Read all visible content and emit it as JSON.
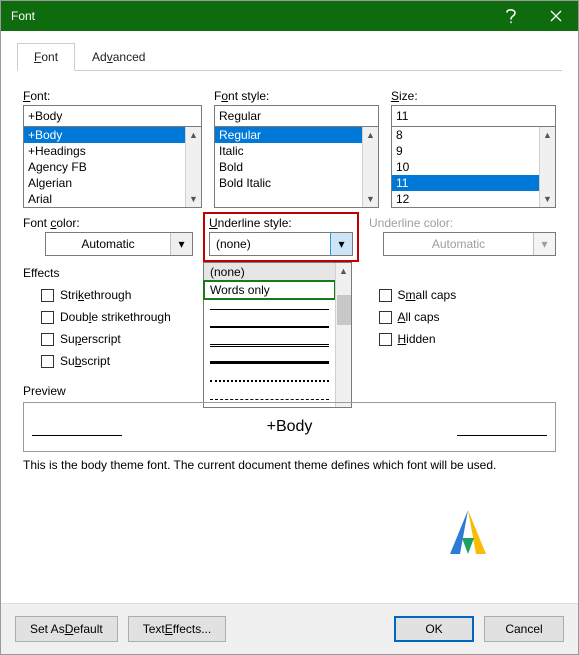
{
  "title": "Font",
  "tabs": {
    "font": "Font",
    "advanced": "Advanced"
  },
  "labels": {
    "font": "Font:",
    "fontstyle": "Font style:",
    "size": "Size:",
    "fontcolor": "Font color:",
    "underlinestyle": "Underline style:",
    "underlinecolor": "Underline color:",
    "effects": "Effects",
    "preview": "Preview"
  },
  "font": {
    "value": "+Body",
    "items": [
      "+Body",
      "+Headings",
      "Agency FB",
      "Algerian",
      "Arial"
    ],
    "selectedIndex": 0
  },
  "fontstyle": {
    "value": "Regular",
    "items": [
      "Regular",
      "Italic",
      "Bold",
      "Bold Italic"
    ],
    "selectedIndex": 0
  },
  "size": {
    "value": "11",
    "items": [
      "8",
      "9",
      "10",
      "11",
      "12"
    ],
    "selectedIndex": 3
  },
  "fontcolor": {
    "value": "Automatic"
  },
  "underlinestyle": {
    "value": "(none)",
    "options": [
      "(none)",
      "Words only"
    ],
    "highlighted": "Words only"
  },
  "underlinecolor": {
    "value": "Automatic",
    "enabled": false
  },
  "effects": {
    "left": [
      "Strikethrough",
      "Double strikethrough",
      "Superscript",
      "Subscript"
    ],
    "right": [
      "Small caps",
      "All caps",
      "Hidden"
    ]
  },
  "preview": {
    "text": "+Body",
    "hint": "This is the body theme font. The current document theme defines which font will be used."
  },
  "buttons": {
    "default": "Set As Default",
    "texteffects": "Text Effects...",
    "ok": "OK",
    "cancel": "Cancel"
  }
}
